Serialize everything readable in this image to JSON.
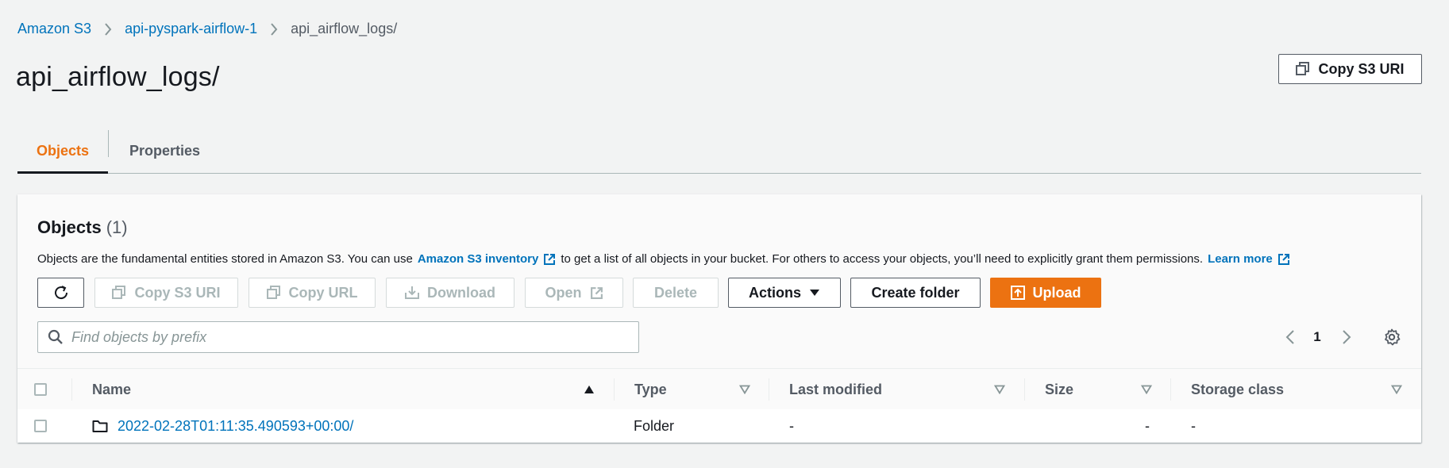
{
  "breadcrumb": {
    "items": [
      {
        "label": "Amazon S3"
      },
      {
        "label": "api-pyspark-airflow-1"
      }
    ],
    "current": "api_airflow_logs/"
  },
  "page": {
    "title": "api_airflow_logs/",
    "copy_uri_label": "Copy S3 URI"
  },
  "tabs": [
    {
      "label": "Objects",
      "active": true
    },
    {
      "label": "Properties",
      "active": false
    }
  ],
  "objects_panel": {
    "title": "Objects",
    "count": "(1)",
    "desc_part1": "Objects are the fundamental entities stored in Amazon S3. You can use",
    "desc_link1": "Amazon S3 inventory",
    "desc_part2": "to get a list of all objects in your bucket. For others to access your objects, you’ll need to explicitly grant them permissions.",
    "desc_link2": "Learn more"
  },
  "toolbar": {
    "copy_s3_uri": "Copy S3 URI",
    "copy_url": "Copy URL",
    "download": "Download",
    "open": "Open",
    "delete": "Delete",
    "actions": "Actions",
    "create_folder": "Create folder",
    "upload": "Upload"
  },
  "search": {
    "placeholder": "Find objects by prefix",
    "value": ""
  },
  "pagination": {
    "current_page": "1"
  },
  "table": {
    "columns": [
      "Name",
      "Type",
      "Last modified",
      "Size",
      "Storage class"
    ],
    "rows": [
      {
        "name": "2022-02-28T01:11:35.490593+00:00/",
        "type": "Folder",
        "last_modified": "-",
        "size": "-",
        "storage_class": "-"
      }
    ]
  },
  "colors": {
    "accent_orange": "#ec7211",
    "link_blue": "#0073bb",
    "text_dark": "#16191f",
    "text_grey": "#545b64",
    "background": "#f2f3f3"
  },
  "icons": [
    "chevron-right-icon",
    "copy-icon",
    "refresh-icon",
    "download-icon",
    "external-link-icon",
    "caret-down-icon",
    "upload-icon",
    "search-icon",
    "chevron-left-icon",
    "gear-icon",
    "sort-ascending-icon",
    "sort-descending-icon",
    "folder-icon"
  ]
}
